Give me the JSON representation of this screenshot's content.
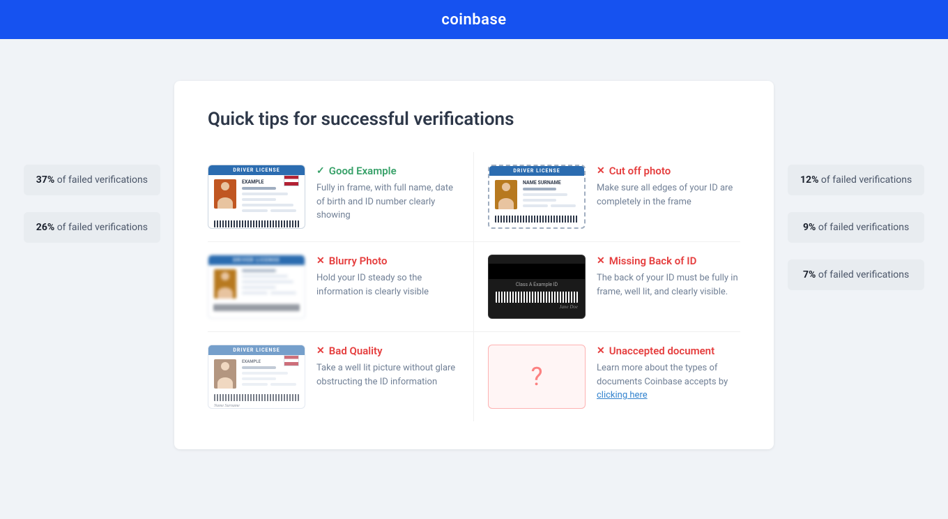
{
  "header": {
    "logo": "coinbase"
  },
  "page": {
    "title": "Quick tips for successful verifications"
  },
  "side_badges_left": [
    {
      "percent": "37%",
      "label": "of failed verifications"
    },
    {
      "percent": "26%",
      "label": "of failed verifications"
    }
  ],
  "side_badges_right": [
    {
      "percent": "12%",
      "label": "of failed verifications"
    },
    {
      "percent": "9%",
      "label": "of failed verifications"
    },
    {
      "percent": "7%",
      "label": "of failed verifications"
    }
  ],
  "tips": [
    {
      "id": "good-example",
      "status": "good",
      "status_icon": "✓",
      "title": "Good Example",
      "description": "Fully in frame, with full name, date of birth and ID number clearly showing",
      "card_type": "good"
    },
    {
      "id": "cut-off",
      "status": "bad",
      "status_icon": "✕",
      "title": "Cut off photo",
      "description": "Make sure all edges of your ID are completely in the frame",
      "card_type": "cutoff"
    },
    {
      "id": "blurry",
      "status": "bad",
      "status_icon": "✕",
      "title": "Blurry Photo",
      "description": "Hold your ID steady so the information is clearly visible",
      "card_type": "blurry"
    },
    {
      "id": "missing-back",
      "status": "bad",
      "status_icon": "✕",
      "title": "Missing Back of ID",
      "description": "The back of your ID must be fully in frame, well lit, and clearly visible.",
      "card_type": "back"
    },
    {
      "id": "bad-quality",
      "status": "bad",
      "status_icon": "✕",
      "title": "Bad Quality",
      "description": "Take a well lit picture without glare obstructing the ID information",
      "card_type": "glare"
    },
    {
      "id": "unaccepted",
      "status": "bad",
      "status_icon": "✕",
      "title": "Unaccepted document",
      "description": "Learn more about the types of documents Coinbase accepts by ",
      "link_text": "clicking here",
      "card_type": "unaccepted"
    }
  ]
}
